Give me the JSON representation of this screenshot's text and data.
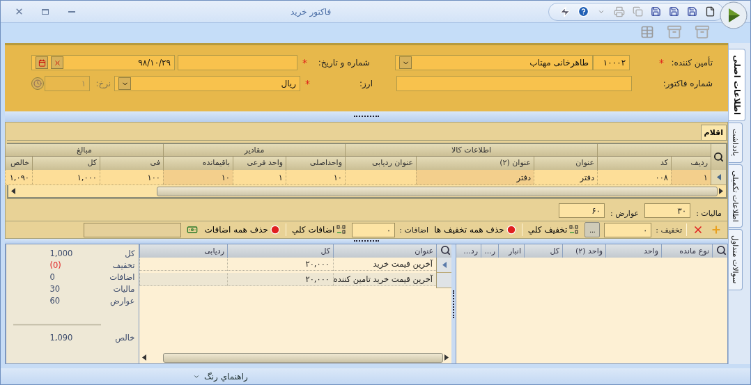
{
  "window": {
    "title": "فاکتور خرید"
  },
  "side_tabs": [
    {
      "label": "اطلاعات اصلی",
      "selected": true
    },
    {
      "label": "یادداشت",
      "selected": false
    },
    {
      "label": "اطلاعات تکمیلی",
      "selected": false
    },
    {
      "label": "سوالات متداول",
      "selected": false
    }
  ],
  "header_form": {
    "supplier": {
      "label": "تأمین کننده:",
      "required_mark": "*",
      "code": "۱۰۰۰۲",
      "name": "طاهرخانی مهتاب"
    },
    "number_date": {
      "label": "شماره و تاریخ:",
      "required_mark": "*",
      "date": "۹۸/۱۰/۲۹"
    },
    "invoice_number": {
      "label": "شماره فاکتور:"
    },
    "currency": {
      "label": "ارز:",
      "required_mark": "*",
      "value": "ریال"
    },
    "rate": {
      "label": "نرخ:",
      "value": "۱",
      "disabled": true
    }
  },
  "items_tab": {
    "label": "اقلام",
    "selected": true
  },
  "items_grid": {
    "groups": [
      {
        "columns": [
          "ردیف",
          "کد"
        ]
      },
      {
        "label": "اطلاعات کالا",
        "columns": [
          "عنوان",
          "عنوان (۲)",
          "عنوان ردیابی"
        ]
      },
      {
        "label": "مقادیر",
        "columns": [
          "واحداصلی",
          "واحد فرعی",
          "باقیمانده"
        ]
      },
      {
        "label": "مبالغ",
        "columns": [
          "فی",
          "کل",
          "خالص"
        ]
      }
    ],
    "rows": [
      {
        "selected": true,
        "cells": [
          "۱",
          "۰۰۸",
          "دفتر",
          "دفتر",
          null,
          "۱۰",
          "۱",
          "۱۰",
          "۱۰۰",
          "۱,۰۰۰",
          "۱,۰۹۰"
        ]
      }
    ]
  },
  "taxes": [
    {
      "label": "مالیات :",
      "value": "۳۰"
    },
    {
      "label": "عوارض :",
      "value": "۶۰"
    }
  ],
  "adjust_toolbar": {
    "discount_label": "تخفیف :",
    "discount_value": "۰",
    "more": "...",
    "discount_all": "تخفیف کلي",
    "remove_discounts": "حذف همه تخفیف ها",
    "addition_label": "اضافات :",
    "addition_value": "۰",
    "addition_all": "اضافات کلي",
    "remove_additions": "حذف همه اضافات"
  },
  "summary": [
    {
      "label": "کل",
      "value": "1,000",
      "kind": "normal"
    },
    {
      "label": "تخفیف",
      "value": "(0)",
      "kind": "deduction"
    },
    {
      "label": "اضافات",
      "value": "0",
      "kind": "normal"
    },
    {
      "label": "مالیات",
      "value": "30",
      "kind": "normal"
    },
    {
      "label": "عوارض",
      "value": "60",
      "kind": "normal"
    }
  ],
  "summary_total": {
    "label": "خالص",
    "value": "1,090"
  },
  "price_grid": {
    "columns": [
      "عنوان",
      "کل",
      "ردیابی"
    ],
    "rows": [
      {
        "selected": true,
        "cells": [
          "آخرین قیمت خرید",
          "۲۰,۰۰۰",
          null
        ]
      },
      {
        "selected": false,
        "cells": [
          "آخرین قیمت خرید تامین کننده",
          "۲۰,۰۰۰",
          null
        ]
      }
    ]
  },
  "stock_grid": {
    "columns": [
      "نوع مانده",
      "واحد",
      "واحد (۲)",
      "کل",
      "انبار",
      "ر...",
      "رد..."
    ]
  },
  "status_bar": {
    "color_guide": "راهنماي رنگ"
  }
}
